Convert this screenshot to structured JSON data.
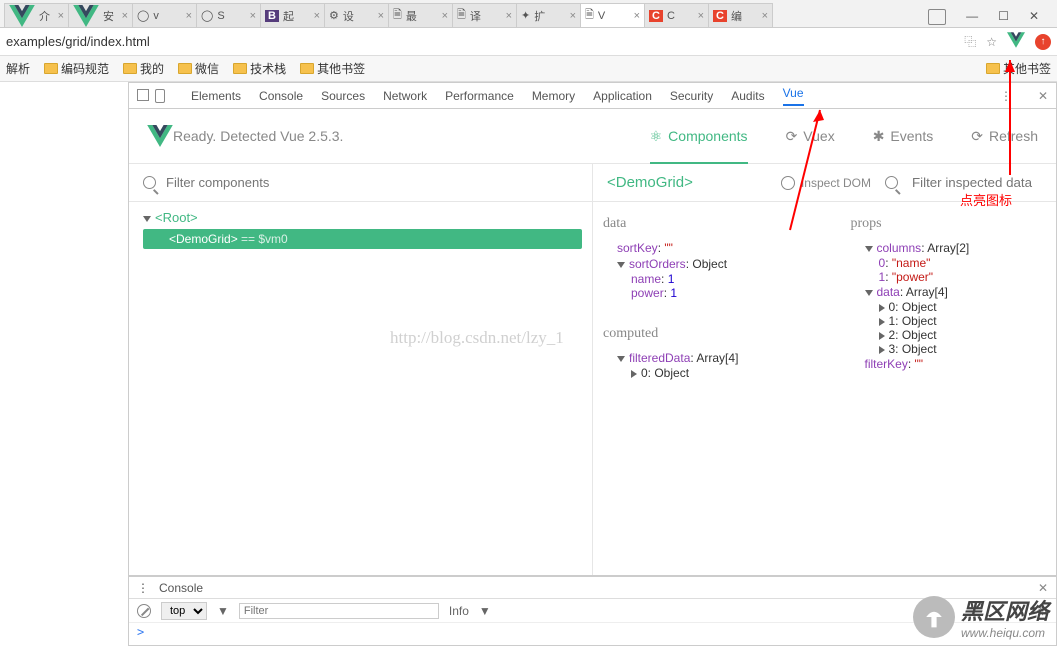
{
  "browser": {
    "tabs": [
      {
        "icon": "vue",
        "label": "介"
      },
      {
        "icon": "vue",
        "label": "安"
      },
      {
        "icon": "gh",
        "label": "v"
      },
      {
        "icon": "gh",
        "label": "S"
      },
      {
        "icon": "b",
        "label": "起"
      },
      {
        "icon": "gear",
        "label": "设"
      },
      {
        "icon": "doc",
        "label": "最"
      },
      {
        "icon": "doc",
        "label": "译"
      },
      {
        "icon": "ext",
        "label": "扩"
      },
      {
        "icon": "doc",
        "label": "V",
        "active": true
      },
      {
        "icon": "c",
        "label": "C"
      },
      {
        "icon": "c",
        "label": "编"
      }
    ],
    "win": [
      "—",
      "☐",
      "✕"
    ],
    "url": "examples/grid/index.html",
    "bookmarks": [
      "解析",
      "编码规范",
      "我的",
      "微信",
      "技术栈",
      "其他书签"
    ],
    "bookmarks_right": "其他书签"
  },
  "devtools": {
    "tabs": [
      "Elements",
      "Console",
      "Sources",
      "Network",
      "Performance",
      "Memory",
      "Application",
      "Security",
      "Audits",
      "Vue"
    ],
    "selected": "Vue",
    "ready": "Ready. Detected Vue 2.5.3.",
    "vuetabs": {
      "components": "Components",
      "vuex": "Vuex",
      "events": "Events",
      "refresh": "Refresh"
    },
    "filter_placeholder": "Filter components",
    "tree": {
      "root": "<Root>",
      "sel": "<DemoGrid>",
      "selsuffix": " == $vm0"
    },
    "right": {
      "tag": "<DemoGrid>",
      "inspect": "Inspect DOM",
      "filter_placeholder": "Filter inspected data",
      "data_title": "data",
      "sortKey_k": "sortKey",
      "sortKey_v": "\"\"",
      "sortOrders_k": "sortOrders",
      "sortOrders_v": "Object",
      "name_k": "name",
      "name_v": "1",
      "power_k": "power",
      "power_v": "1",
      "props_title": "props",
      "columns_k": "columns",
      "columns_v": "Array[2]",
      "c0_k": "0",
      "c0_v": "\"name\"",
      "c1_k": "1",
      "c1_v": "\"power\"",
      "data_k": "data",
      "data_v": "Array[4]",
      "d0": "0: Object",
      "d1": "1: Object",
      "d2": "2: Object",
      "d3": "3: Object",
      "filterKey_k": "filterKey",
      "filterKey_v": "\"\"",
      "computed_title": "computed",
      "filteredData_k": "filteredData",
      "filteredData_v": "Array[4]",
      "fd0": "0: Object"
    }
  },
  "drawer": {
    "tab": "Console",
    "top": "top",
    "filter_placeholder": "Filter",
    "info": "Info",
    "prompt": ">"
  },
  "anno": {
    "label": "点亮图标"
  },
  "watermark": "http://blog.csdn.net/lzy_1",
  "brand": {
    "big": "黑区网络",
    "sm": "www.heiqu.com"
  }
}
